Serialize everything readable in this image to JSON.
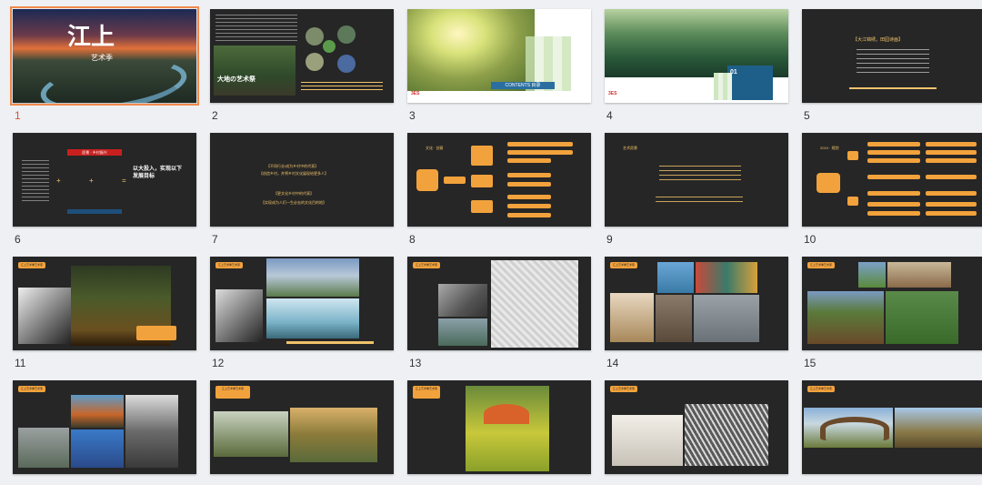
{
  "slides": [
    {
      "n": "1",
      "selected": true
    },
    {
      "n": "2"
    },
    {
      "n": "3"
    },
    {
      "n": "4"
    },
    {
      "n": "5"
    },
    {
      "n": "6"
    },
    {
      "n": "7"
    },
    {
      "n": "8"
    },
    {
      "n": "9"
    },
    {
      "n": "10"
    },
    {
      "n": "11"
    },
    {
      "n": "12"
    },
    {
      "n": "13"
    },
    {
      "n": "14"
    },
    {
      "n": "15"
    },
    {
      "n": "16"
    },
    {
      "n": "17"
    },
    {
      "n": "18"
    },
    {
      "n": "19"
    },
    {
      "n": "20"
    }
  ],
  "text": {
    "s1_title": "江上",
    "s1_sub": "艺术季",
    "s2_title": "大地の艺术祭",
    "s3_contents": "CONTENTS 目录",
    "s3_logo": "3ES",
    "s4_num": "01",
    "s4_logo": "3ES",
    "s5_head": "【大江锦绣，田园诗画】",
    "s6_tag": "愿景 · 乡村振兴",
    "s6_big": "以大投入，实现以下 发展目标",
    "s7_line1": "【不同行业/成为乡村中的代表】",
    "s7_line2": "【创造乡村，并将乡村文化展现给更多人】",
    "s7_line3": "【更文化乡村中的代表】",
    "s7_line4": "【实现成为人们一生必去的文化目的地】",
    "s8_head": "文化 · 创意",
    "s9_head": "艺术愿景",
    "s10_head": "2019 · 规划",
    "s11_tag": "江上艺术季艺术家",
    "s12_tag": "江上艺术季艺术家",
    "s13_tag": "江上艺术季艺术家",
    "s14_tag": "江上艺术季艺术家",
    "s15_tag": "江上艺术季艺术家",
    "s16_tag": "江上艺术季艺术家",
    "s17_tag": "江上艺术季艺术家",
    "s18_tag": "江上艺术季艺术家",
    "s19_tag": "江上艺术季艺术家",
    "s20_tag": "江上艺术季艺术家"
  },
  "colors": {
    "accent": "#f2a23c",
    "slide_bg": "#262626",
    "selected_outline": "#f08a4b"
  }
}
